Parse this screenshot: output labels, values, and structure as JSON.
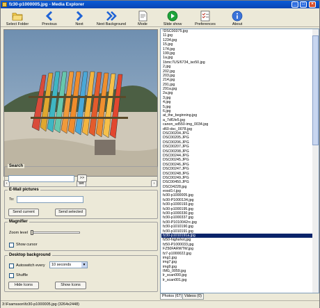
{
  "window": {
    "title": "fz30-p1000005.jpg - Media Explorer"
  },
  "toolbar": {
    "select_folder": "Select Folder",
    "previous": "Previous",
    "next": "Next",
    "next_background": "Next Background",
    "mode": "Mode",
    "slide_show": "Slide show",
    "preferences": "Preferences",
    "about": "About"
  },
  "nav": {
    "prev_symbol": "‹",
    "set_label": "set",
    "next_symbol": "›"
  },
  "search": {
    "title": "Search",
    "go_label": ">>",
    "value": ""
  },
  "email": {
    "title": "E-Mail pictures",
    "to_label": "To:",
    "to_value": "",
    "send_current": "Send current",
    "send_selected": "Send selected"
  },
  "magnifier": {
    "title": "Magnifier",
    "zoom_label": "Zoom level",
    "show_cursor": "Show cursor"
  },
  "desktop": {
    "title": "Desktop background",
    "autoswitch": "Autoswitch every",
    "interval": "10 seconds",
    "shuffle": "Shuffle",
    "hide_icons": "Hide Icons",
    "show_icons": "Show Icons"
  },
  "files": {
    "selected_index": 46,
    "items": [
      "!DSC00375.jpg",
      "11.jpg",
      "1234.jpg",
      "15.jpg",
      "174.jpg",
      "199.jpg",
      "1a.jpg",
      "1bmc7US/6734_iso50.jpg",
      "2.jpg",
      "202.jpg",
      "203.jpg",
      "214.jpg",
      "291.jpg",
      "291a.jpg",
      "2a.jpg",
      "3.jpg",
      "4.jpg",
      "5.jpg",
      "6.jpg",
      "at_the_beginning.jpg",
      "a_7df1fe5.jpg",
      "canon_sd550-img_0034.jpg",
      "d60-dsc_0078.jpg",
      "DSC00204.JPG",
      "DSC00205.JPG",
      "DSC00206.JPG",
      "DSC00207.JPG",
      "DSC00208.JPG",
      "DSC00244.JPG",
      "DSC00245.JPG",
      "DSC00246.JPG",
      "DSC00247.JPG",
      "DSC00248.JPG",
      "DSC00249.JPG",
      "DSC00450.JPG",
      "DSC04228.jpg",
      "eosd1-l.jpg",
      "fz30-p1000005.jpg",
      "fz30-P1000134.jpg",
      "fz30-p1000193.jpg",
      "fz30-p1000195.jpg",
      "fz30-p1000330.jpg",
      "fz30-p1000337.jpg",
      "fz30-P1010042rc.jpg",
      "fz30-p1010190.jpg",
      "fz30-p1010191.jpg",
      "fz30-p1010191a.jpg",
      "fz50-highshot.jpg",
      "fz50-P1000033.jpg",
      "FZ50FARWTW.jpg",
      "fz7-p1000022.jpg",
      "img1.jpg",
      "img7.jpg",
      "img9.jpg",
      "IMG_0059.jpg",
      "lr_scan000.jpg",
      "lr_scan001.jpg"
    ]
  },
  "tabs": {
    "photos": "Photos (67)",
    "videos": "Videos (0)"
  },
  "status": {
    "path": "3:\\Fsamsson\\fz30-p1000005.jpg   (3264x2448)"
  }
}
